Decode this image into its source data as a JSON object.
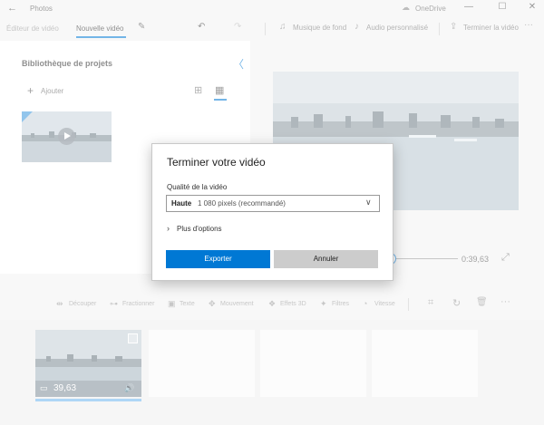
{
  "titlebar": {
    "app_name": "Photos",
    "onedrive_label": "OneDrive",
    "back_glyph": "←",
    "cloud_glyph": "☁",
    "minimize_glyph": "—",
    "maximize_glyph": "☐",
    "close_glyph": "✕"
  },
  "toolbar": {
    "tab_editor": "Éditeur de vidéo",
    "tab_new_video": "Nouvelle vidéo",
    "pencil_glyph": "✎",
    "undo_glyph": "↶",
    "redo_glyph": "↷",
    "background_music": "Musique de fond",
    "custom_audio": "Audio personnalisé",
    "finish_video": "Terminer la vidéo",
    "more_glyph": "···",
    "music_glyph": "♫",
    "audio_glyph": "♪",
    "share_glyph": "⇪"
  },
  "library": {
    "title": "Bibliothèque de projets",
    "add_label": "Ajouter",
    "plus_glyph": "+",
    "collapse_glyph": "〈",
    "grid_small_glyph": "⊞",
    "grid_large_glyph": "▦"
  },
  "playback": {
    "duration": "0:39,63",
    "fullscreen_glyph": "⤢"
  },
  "bottom_toolbar": {
    "items": [
      {
        "label": "Découper",
        "icon": "⇹"
      },
      {
        "label": "Fractionner",
        "icon": "⊶"
      },
      {
        "label": "Texte",
        "icon": "▣"
      },
      {
        "label": "Mouvement",
        "icon": "✥"
      },
      {
        "label": "Effets 3D",
        "icon": "❖"
      },
      {
        "label": "Filtres",
        "icon": "✦"
      },
      {
        "label": "Vitesse",
        "icon": "◔"
      }
    ],
    "crop_glyph": "⌗",
    "rotate_glyph": "↻",
    "delete_glyph": "🗑",
    "more_glyph": "···"
  },
  "storyboard": {
    "card_duration": "39,63",
    "clip_glyph": "▭",
    "volume_glyph": "🔊"
  },
  "dialog": {
    "title": "Terminer votre vidéo",
    "quality_label": "Qualité de la vidéo",
    "quality_strong": "Haute",
    "quality_rest": "1 080 pixels (recommandé)",
    "chevron_down_glyph": "∨",
    "more_options_glyph": "›",
    "more_options": "Plus d'options",
    "export_label": "Exporter",
    "cancel_label": "Annuler"
  },
  "colors": {
    "accent": "#0078d4",
    "overlay": "rgba(255,255,255,0.45)"
  }
}
